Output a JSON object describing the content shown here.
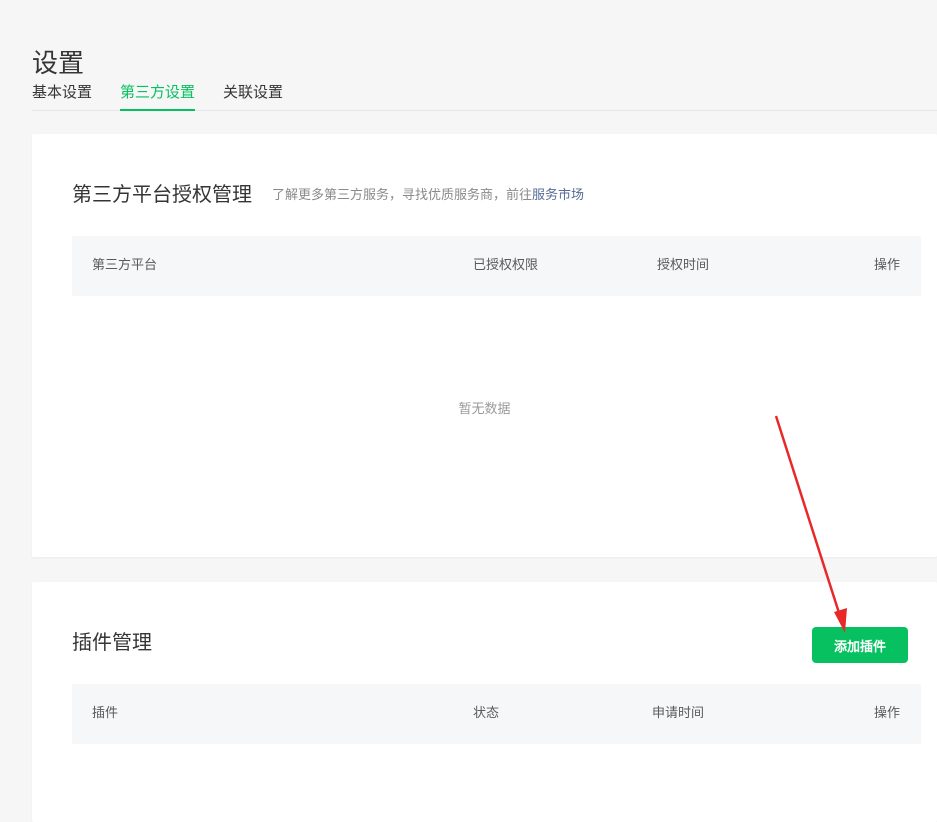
{
  "page": {
    "title": "设置"
  },
  "tabs": [
    {
      "label": "基本设置",
      "active": false
    },
    {
      "label": "第三方设置",
      "active": true
    },
    {
      "label": "关联设置",
      "active": false
    }
  ],
  "auth_section": {
    "title": "第三方平台授权管理",
    "desc_prefix": "了解更多第三方服务，寻找优质服务商，前往",
    "market_link": "服务市场",
    "columns": [
      "第三方平台",
      "已授权权限",
      "授权时间",
      "操作"
    ],
    "empty_text": "暂无数据"
  },
  "plugin_section": {
    "title": "插件管理",
    "add_button": "添加插件",
    "columns": [
      "插件",
      "状态",
      "申请时间",
      "操作"
    ]
  },
  "colors": {
    "accent": "#07c160",
    "annotation_arrow": "#e8292a",
    "link": "#576b95"
  }
}
